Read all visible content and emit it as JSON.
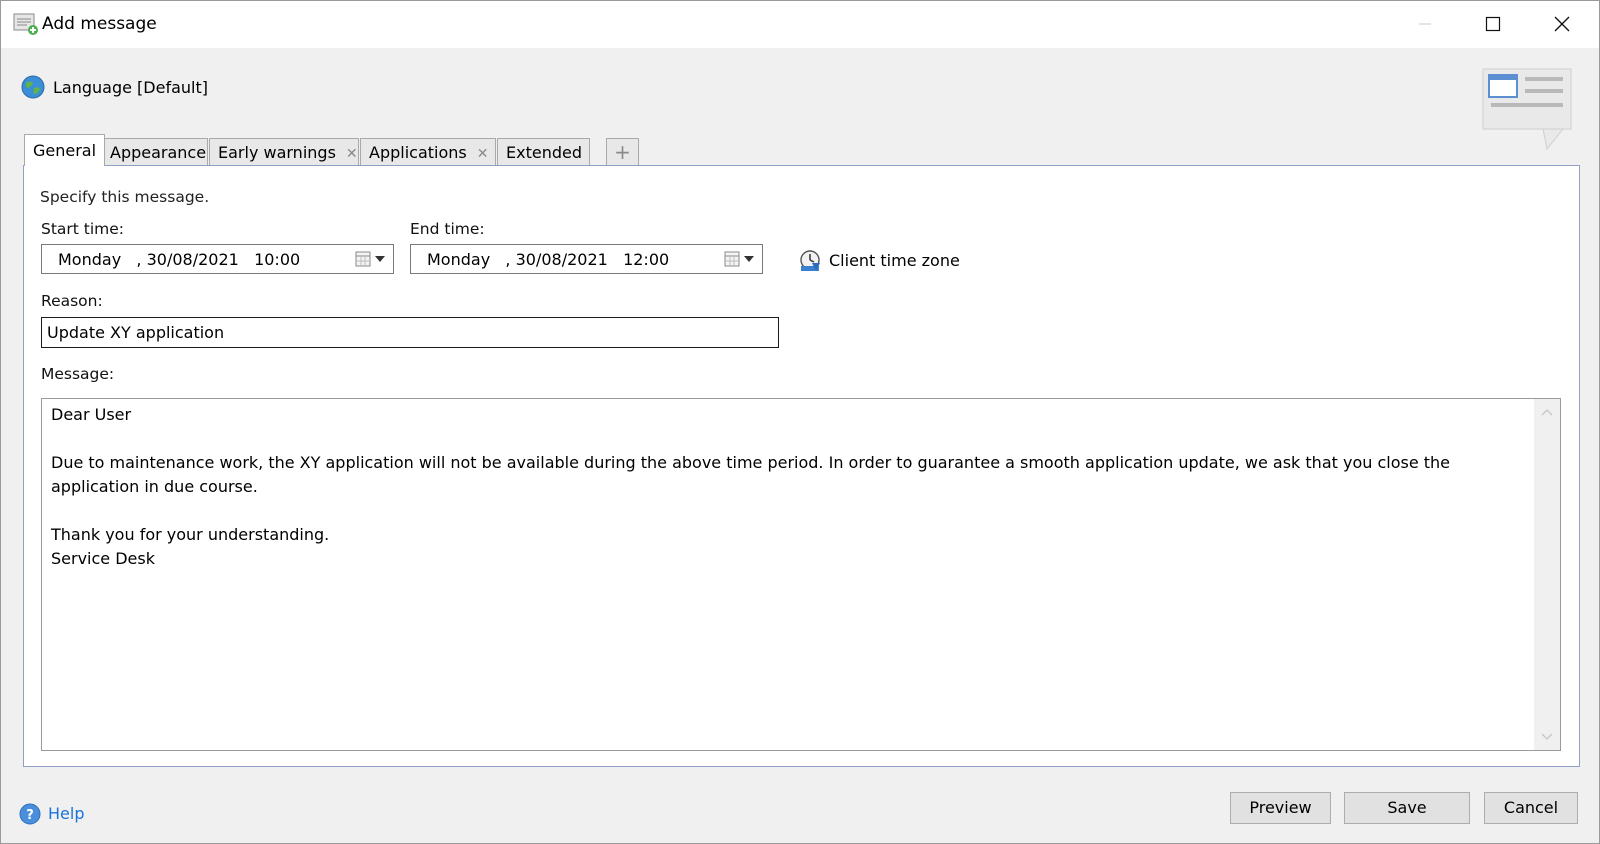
{
  "window": {
    "title": "Add message",
    "title_icon": "message-add-icon",
    "controls": {
      "minimize": "minimize-icon",
      "maximize": "maximize-icon",
      "close": "close-icon"
    }
  },
  "language": {
    "label": "Language [Default]",
    "icon": "globe-icon"
  },
  "tabs": [
    {
      "label": "General",
      "active": true,
      "closable": false
    },
    {
      "label": "Appearance",
      "active": false,
      "closable": false
    },
    {
      "label": "Early warnings",
      "active": false,
      "closable": true
    },
    {
      "label": "Applications",
      "active": false,
      "closable": true
    },
    {
      "label": "Extended",
      "active": false,
      "closable": false
    }
  ],
  "tab_add_label": "+",
  "tab_close_glyph": "✕",
  "general": {
    "hint": "Specify this message.",
    "start_label": "Start time:",
    "start_value": "Monday   , 30/08/2021   10:00",
    "end_label": "End time:",
    "end_value": "Monday   , 30/08/2021   12:00",
    "timezone_label": "Client time zone",
    "reason_label": "Reason:",
    "reason_value": "Update XY application",
    "message_label": "Message:",
    "message_value": "Dear User\n\nDue to maintenance work, the XY application will not be available during the above time period. In order to guarantee a smooth application update, we ask that you close the application in due course.\n\nThank you for your understanding.\nService Desk"
  },
  "footer": {
    "help_label": "Help",
    "preview_label": "Preview",
    "save_label": "Save",
    "cancel_label": "Cancel"
  },
  "colors": {
    "accent_link": "#1a73d9",
    "panel_border": "#8fa0c4",
    "window_bg": "#f0f0f0"
  }
}
